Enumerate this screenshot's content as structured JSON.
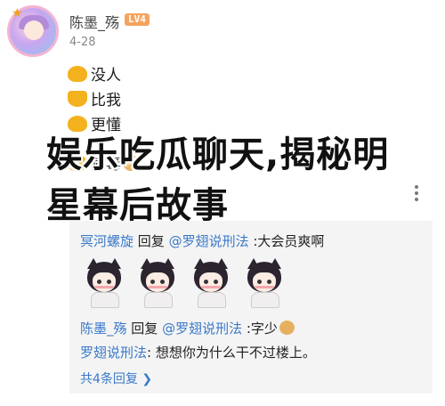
{
  "header": {
    "username": "陈墨_殇",
    "level_badge": "LV4",
    "date": "4-28"
  },
  "post": {
    "lines": [
      "没人",
      "比我",
      "更懂",
      "病毒"
    ]
  },
  "overlay": {
    "line1": "娱乐吃瓜聊天,揭秘明",
    "line2": "星幕后故事"
  },
  "replies": [
    {
      "user": "冥河螺旋",
      "action": " 回复 ",
      "target": "@罗翅说刑法",
      "text": " :大会员爽啊"
    },
    {
      "user": "陈墨_殇",
      "action": " 回复 ",
      "target": "@罗翅说刑法",
      "text": " :字少"
    },
    {
      "user": "罗翅说刑法",
      "action": ": ",
      "target": "",
      "text": "想想你为什么干不过楼上。"
    }
  ],
  "total_replies": "共4条回复 ❯",
  "icons": {
    "avatar": "avatar-image",
    "level": "level-badge",
    "more": "more-vertical-icon",
    "doge": "doge-emoji-icon",
    "chevron": "chevron-right-icon"
  },
  "colors": {
    "link_blue": "#3a79c8",
    "level_orange": "#f5a35e",
    "reply_bg": "#f4f4f4"
  }
}
